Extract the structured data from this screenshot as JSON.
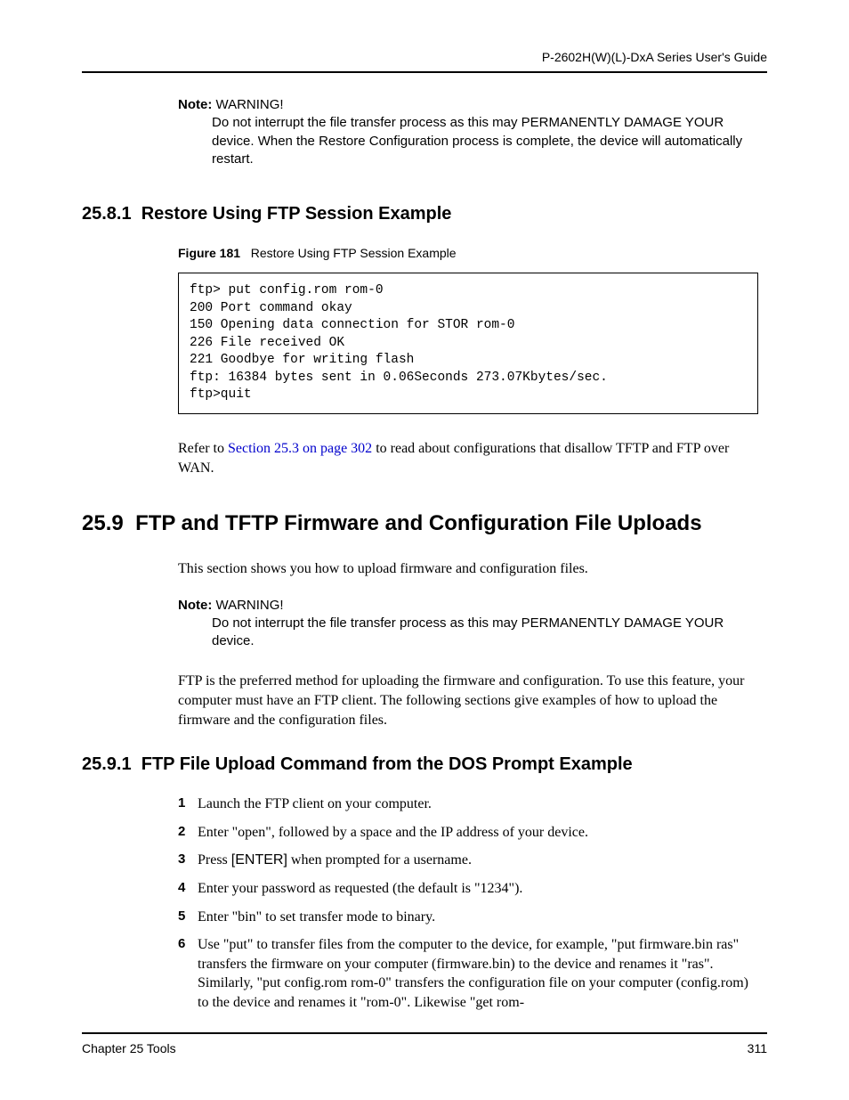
{
  "header": "P-2602H(W)(L)-DxA Series User's Guide",
  "note1": {
    "label": "Note:",
    "title": " WARNING!",
    "body": "Do not interrupt the file transfer process as this may PERMANENTLY DAMAGE YOUR device. When the Restore Configuration process is complete, the device will automatically restart."
  },
  "section_25_8_1": {
    "number": "25.8.1",
    "title": "Restore Using FTP Session Example"
  },
  "figure": {
    "number": "Figure 181",
    "caption": "Restore Using FTP Session Example"
  },
  "code": "ftp> put config.rom rom-0\n200 Port command okay\n150 Opening data connection for STOR rom-0\n226 File received OK\n221 Goodbye for writing flash\nftp: 16384 bytes sent in 0.06Seconds 273.07Kbytes/sec.\nftp>quit",
  "para1_a": "Refer to ",
  "para1_link": "Section 25.3 on page 302",
  "para1_b": " to read about configurations that disallow TFTP and FTP over WAN.",
  "section_25_9": {
    "number": "25.9",
    "title": "FTP and TFTP Firmware and Configuration File Uploads"
  },
  "para2": "This section shows you how to upload firmware and configuration files.",
  "note2": {
    "label": "Note:",
    "title": " WARNING!",
    "body": "Do not interrupt the file transfer process as this may PERMANENTLY DAMAGE YOUR device."
  },
  "para3": "FTP is the preferred method for uploading the firmware and configuration. To use this feature, your computer must have an FTP client. The following sections give examples of how to upload the firmware and the configuration files.",
  "section_25_9_1": {
    "number": "25.9.1",
    "title": "FTP File Upload Command from the DOS Prompt Example"
  },
  "steps": [
    {
      "num": "1",
      "text": "Launch the FTP client on your computer."
    },
    {
      "num": "2",
      "text": "Enter \"open\", followed by a space and the IP address of your device."
    },
    {
      "num": "3",
      "text_a": "Press ",
      "enter": "[ENTER]",
      "text_b": " when prompted for a username."
    },
    {
      "num": "4",
      "text": "Enter your password as requested (the default is \"1234\")."
    },
    {
      "num": "5",
      "text": "Enter \"bin\" to set transfer mode to binary."
    },
    {
      "num": "6",
      "text": "Use \"put\" to transfer files from the computer to the device, for example, \"put firmware.bin ras\" transfers the firmware on your computer (firmware.bin) to the device and renames it \"ras\". Similarly, \"put config.rom rom-0\" transfers the configuration file on your computer (config.rom) to the device and renames it \"rom-0\". Likewise \"get rom-"
    }
  ],
  "footer": {
    "left": "Chapter 25 Tools",
    "right": "311"
  }
}
